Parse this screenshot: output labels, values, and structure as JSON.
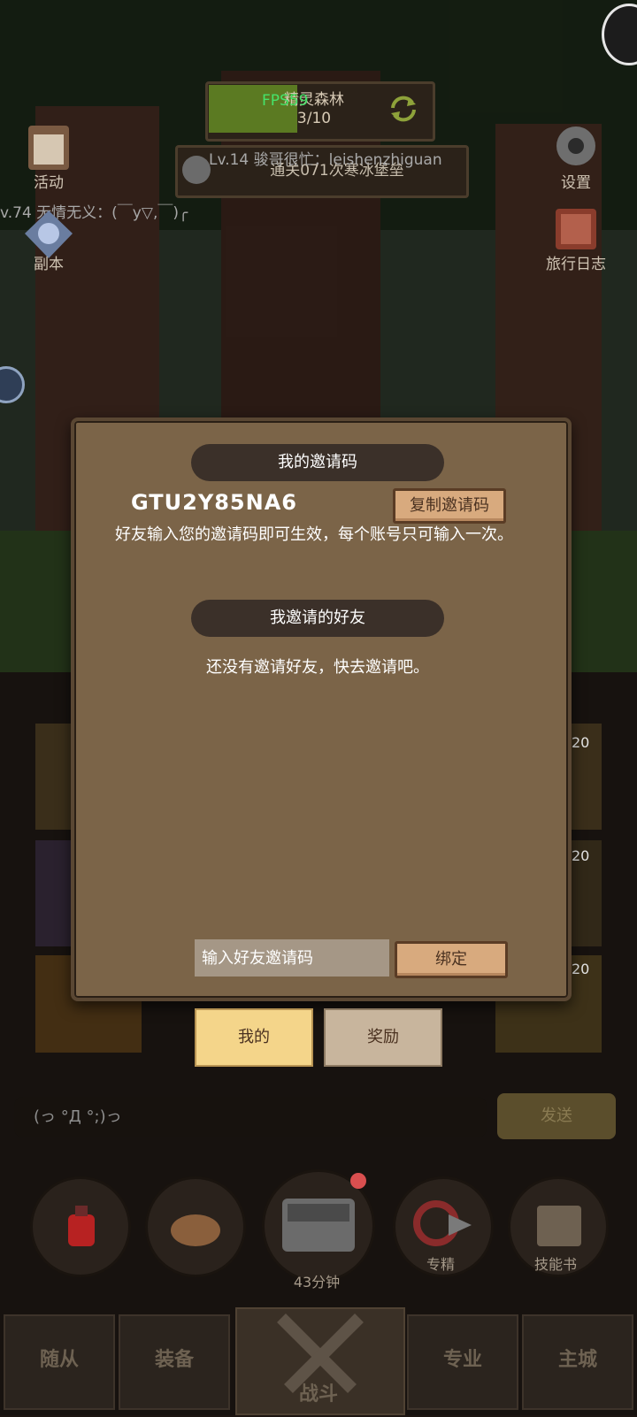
{
  "hud": {
    "fps": "FPS59",
    "stage_name": "精灵森林",
    "stage_progress": "3/10",
    "boss_text": "通关071次寒冰堡垒",
    "chat_messages": [
      "Lv.14 骏哥很忙：leishenzhiguan",
      "v.74 无情无义：(￣y▽,￣)╭"
    ],
    "left_menu": [
      "活动",
      "副本"
    ],
    "right_menu": [
      "设置",
      "旅行日志"
    ]
  },
  "invite_dialog": {
    "my_code_title": "我的邀请码",
    "invite_code": "GTU2Y85NA6",
    "copy_button": "复制邀请码",
    "tip": "好友输入您的邀请码即可生效，每个账号只可输入一次。",
    "friends_title": "我邀请的好友",
    "friends_empty": "还没有邀请好友，快去邀请吧。",
    "input_placeholder": "输入好友邀请码",
    "bind_button": "绑定"
  },
  "dialog_tabs": [
    "我的",
    "奖励"
  ],
  "item_levels": [
    "20",
    "20",
    "20"
  ],
  "chat": {
    "input_text": "(っ °Д °;)っ",
    "send_button": "发送"
  },
  "quick_slots": [
    {
      "label": "",
      "icon": "potion-icon"
    },
    {
      "label": "",
      "icon": "bread-icon"
    },
    {
      "label": "43分钟",
      "icon": "chest-icon"
    },
    {
      "label": "专精",
      "icon": "mastery-icon"
    },
    {
      "label": "技能书",
      "icon": "skill-book-icon"
    }
  ],
  "bottom_nav": [
    "随从",
    "装备",
    "战斗",
    "专业",
    "主城"
  ],
  "colors": {
    "panel": "#7b6448",
    "ribbon": "#3b3029",
    "active_tab": "#f4d58a",
    "fps": "#46e36a"
  }
}
